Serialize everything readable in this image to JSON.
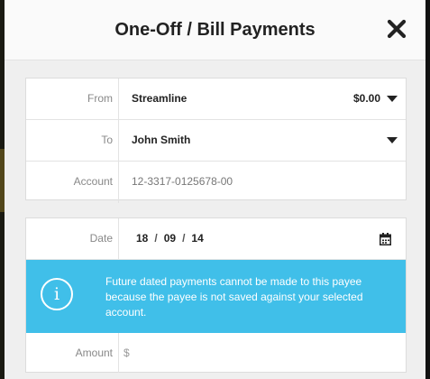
{
  "modal": {
    "title": "One-Off / Bill Payments"
  },
  "payment": {
    "from": {
      "label": "From",
      "value": "Streamline",
      "balance": "$0.00"
    },
    "to": {
      "label": "To",
      "value": "John Smith"
    },
    "account": {
      "label": "Account",
      "value": "12-3317-0125678-00"
    }
  },
  "schedule": {
    "date": {
      "label": "Date",
      "day": "18",
      "month": "09",
      "year": "14",
      "separator": "/"
    },
    "notice": {
      "text": "Future dated payments cannot be made to this payee because the payee is not saved against your selected account."
    },
    "amount": {
      "label": "Amount",
      "placeholder": "$"
    }
  },
  "colors": {
    "info_banner": "#40bfe9",
    "header_bg": "#fafafa",
    "panel_bg": "#efefef"
  },
  "icons": [
    "close-icon",
    "dropdown-caret-icon",
    "calendar-icon",
    "info-icon"
  ]
}
